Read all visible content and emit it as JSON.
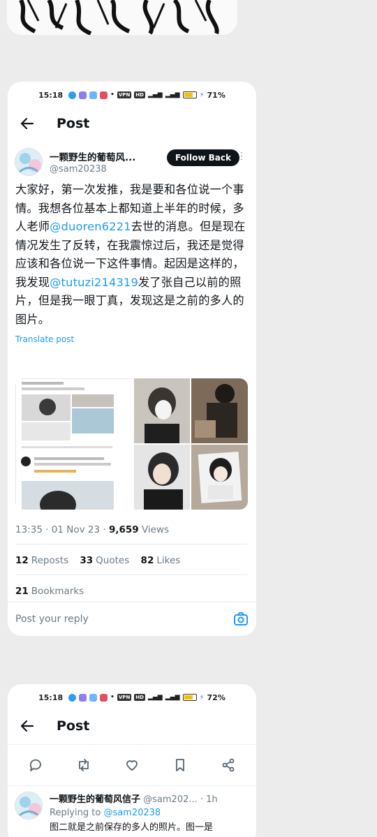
{
  "card1": {
    "status": {
      "time": "15:18",
      "vpn": "VPN",
      "hd": "HD",
      "battery": "71%",
      "battery_level": 0.71
    },
    "header": {
      "title": "Post"
    },
    "author": {
      "name": "一颗野生的葡萄风...",
      "handle": "@sam20238",
      "follow_label": "Follow Back"
    },
    "body": {
      "t1": "大家好，第一次发推，我是要和各位说一个事情。我想各位基本上都知道上半年的时候，多人老师",
      "m1": "@duoren6221",
      "t2": "去世的消息。但是现在情况发生了反转，在我震惊过后，我还是觉得应该和各位说一下这件事情。起因是这样的，我发现",
      "m2": "@tutuzi214319",
      "t3": "发了张自己以前的照片，但是我一眼丁真，发现这是之前的多人的图片。"
    },
    "translate_label": "Translate post",
    "meta": {
      "time": "13:35 · 01 Nov 23 · ",
      "views_count": "9,659",
      "views_label": " Views"
    },
    "stats": {
      "reposts_count": "12",
      "reposts_label": "Reposts",
      "quotes_count": "33",
      "quotes_label": "Quotes",
      "likes_count": "82",
      "likes_label": "Likes",
      "bookmarks_count": "21",
      "bookmarks_label": "Bookmarks"
    },
    "reply_placeholder": "Post your reply"
  },
  "card2": {
    "status": {
      "time": "15:18",
      "vpn": "VPN",
      "hd": "HD",
      "battery": "72%",
      "battery_level": 0.72
    },
    "header": {
      "title": "Post"
    },
    "reply": {
      "name": "一颗野生的葡萄风信子",
      "handle": " @sam202... · 1h",
      "replying_label": "Replying to ",
      "replying_handle": "@sam20238",
      "text": "图二就是之前保存的多人的照片。图一是"
    }
  },
  "colors": {
    "link": "#1d9bf0",
    "text": "#0f1419",
    "muted": "#6b7a87",
    "follow_bg": "#0f1419"
  }
}
